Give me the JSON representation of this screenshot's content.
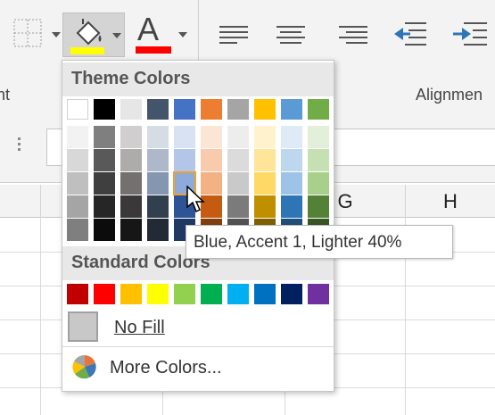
{
  "ribbon": {
    "group_left_label": "nt",
    "group_alignment_label": "Alignmen"
  },
  "columns": [
    "G",
    "H"
  ],
  "palette": {
    "theme_title": "Theme Colors",
    "standard_title": "Standard Colors",
    "theme_row": [
      "#FFFFFF",
      "#000000",
      "#E7E6E6",
      "#44546A",
      "#4472C4",
      "#ED7D31",
      "#A5A5A5",
      "#FFC000",
      "#5B9BD5",
      "#70AD47"
    ],
    "shades": [
      [
        "#F2F2F2",
        "#7F7F7F",
        "#D0CECE",
        "#D6DCE4",
        "#D9E2F3",
        "#FBE5D5",
        "#EDEDED",
        "#FFF2CC",
        "#DEEBF6",
        "#E2EFD9"
      ],
      [
        "#D8D8D8",
        "#595959",
        "#AEABAB",
        "#ADB9CA",
        "#B4C6E7",
        "#F7CBAC",
        "#DBDBDB",
        "#FEE599",
        "#BDD7EE",
        "#C5E0B3"
      ],
      [
        "#BFBFBF",
        "#3F3F3F",
        "#757070",
        "#8496B0",
        "#8EAADB",
        "#F4B183",
        "#C9C9C9",
        "#FFD965",
        "#9DC3E6",
        "#A8D08D"
      ],
      [
        "#A5A5A5",
        "#262626",
        "#3A3838",
        "#323F4F",
        "#2F5496",
        "#C55A11",
        "#7B7B7B",
        "#BF8F00",
        "#2E75B5",
        "#538135"
      ],
      [
        "#7F7F7F",
        "#0C0C0C",
        "#171616",
        "#222A35",
        "#1F3864",
        "#833C0B",
        "#525252",
        "#7F6000",
        "#1E4E79",
        "#375623"
      ]
    ],
    "standard": [
      "#C00000",
      "#FF0000",
      "#FFC000",
      "#FFFF00",
      "#92D050",
      "#00B050",
      "#00B0F0",
      "#0070C0",
      "#002060",
      "#7030A0"
    ],
    "no_fill_label": "No Fill",
    "more_colors_label": "More Colors...",
    "tooltip": "Blue, Accent 1, Lighter 40%"
  },
  "colors": {
    "fill_bar": "#FFFF00",
    "font_bar": "#FF0000",
    "selected_outline": "#F0A030"
  }
}
